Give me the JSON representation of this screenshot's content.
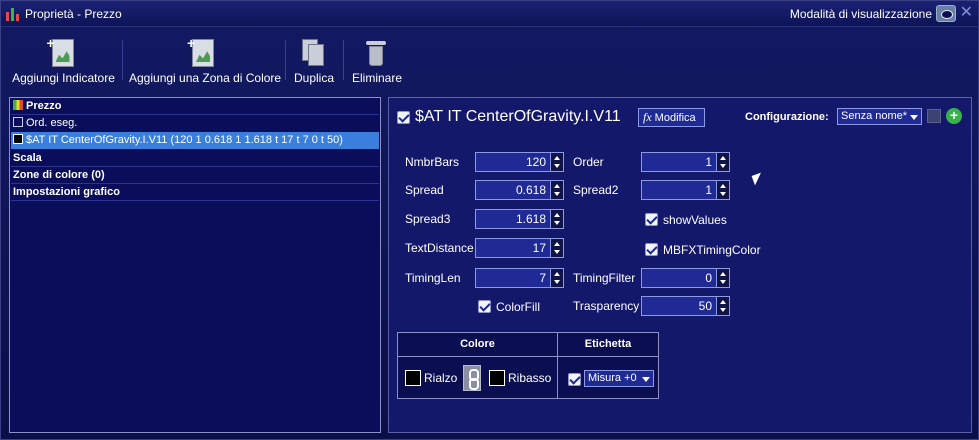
{
  "window": {
    "title": "Proprietà - Prezzo",
    "visualization_mode": "Modalità di visualizzazione",
    "icons": {
      "app": "candlestick-chart-icon",
      "eye": "eye-icon",
      "close": "close-icon"
    },
    "close_glyph": "✕"
  },
  "toolbar": {
    "add_indicator": "Aggiungi Indicatore",
    "add_color_zone": "Aggiungi una Zona di Colore",
    "duplicate": "Duplica",
    "delete": "Eliminare"
  },
  "tree": {
    "items": [
      {
        "label": "Prezzo",
        "type": "header-flag"
      },
      {
        "label": "Ord. eseg.",
        "type": "checkbox"
      },
      {
        "label": "$AT IT CenterOfGravity.I.V11 (120 1 0.618 1 1.618 t 17 t 7 0 t 50)",
        "type": "selected"
      },
      {
        "label": "Scala",
        "type": "header"
      },
      {
        "label": "Zone di colore (0)",
        "type": "header"
      },
      {
        "label": "Impostazioni grafico",
        "type": "header"
      }
    ]
  },
  "indicator": {
    "title": "$AT IT CenterOfGravity.I.V11",
    "fx": "fx",
    "modify": "Modifica",
    "config_label": "Configurazione:",
    "config_value": "Senza nome*",
    "add_glyph": "+"
  },
  "params": {
    "nmbrbars": {
      "label": "NmbrBars",
      "value": "120"
    },
    "order": {
      "label": "Order",
      "value": "1"
    },
    "spread": {
      "label": "Spread",
      "value": "0.618"
    },
    "spread2": {
      "label": "Spread2",
      "value": "1"
    },
    "spread3": {
      "label": "Spread3",
      "value": "1.618"
    },
    "show_values": {
      "label": "showValues"
    },
    "text_distance": {
      "label": "TextDistance",
      "value": "17"
    },
    "mbfx": {
      "label": "MBFXTimingColor"
    },
    "timing_len": {
      "label": "TimingLen",
      "value": "7"
    },
    "timing_filter": {
      "label": "TimingFilter",
      "value": "0"
    },
    "color_fill": {
      "label": "ColorFill"
    },
    "transparency": {
      "label": "Trasparency",
      "value": "50"
    }
  },
  "color_table": {
    "headers": {
      "color": "Colore",
      "label": "Etichetta"
    },
    "up": "Rialzo",
    "down": "Ribasso",
    "measure": "Misura +0"
  },
  "colors": {
    "background": "#0c1050",
    "panel": "#14186b",
    "selection": "#3a7fdc",
    "field": "#1f2a94",
    "accent_green": "#37b34a"
  }
}
